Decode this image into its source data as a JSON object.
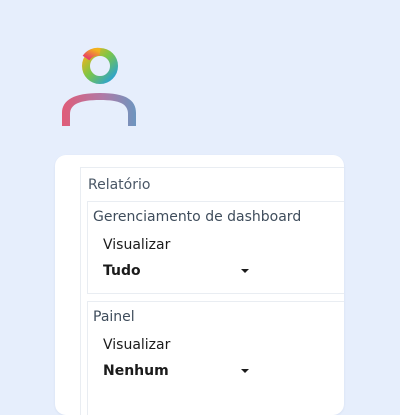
{
  "user": {
    "avatar_icon": "user-avatar-icon",
    "head_gradient": [
      "#e83a6a",
      "#f2b21e",
      "#7cc646",
      "#26a0d9"
    ],
    "body_gradient": [
      "#e05c78",
      "#7f86c9",
      "#6d95bf"
    ]
  },
  "report": {
    "title": "Relatório",
    "sections": [
      {
        "title": "Gerenciamento de dashboard",
        "field_label": "Visualizar",
        "selected_value": "Tudo"
      },
      {
        "title": "Painel",
        "field_label": "Visualizar",
        "selected_value": "Nenhum"
      }
    ]
  }
}
